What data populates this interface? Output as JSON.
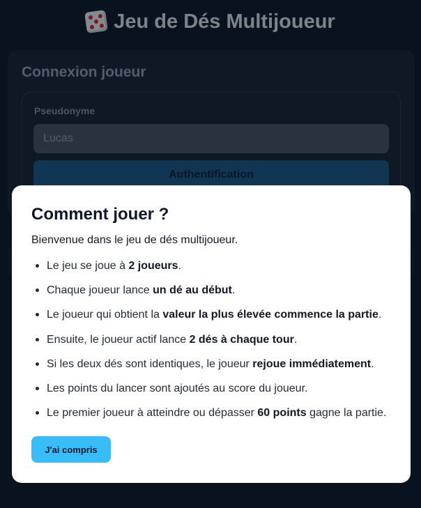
{
  "app": {
    "title_emoji": "🎲",
    "title": "Jeu de Dés Multijoueur"
  },
  "login": {
    "title": "Connexion joueur",
    "pseudo_label": "Pseudonyme",
    "pseudo_value": "Lucas",
    "auth_label": "Authentification"
  },
  "modal": {
    "title": "Comment jouer ?",
    "intro": "Bienvenue dans le jeu de dés multijoueur.",
    "rules": [
      {
        "before": "Le jeu se joue à ",
        "bold": "2 joueurs",
        "after": "."
      },
      {
        "before": "Chaque joueur lance ",
        "bold": "un dé au début",
        "after": "."
      },
      {
        "before": "Le joueur qui obtient la ",
        "bold": "valeur la plus élevée commence la partie",
        "after": "."
      },
      {
        "before": "Ensuite, le joueur actif lance ",
        "bold": "2 dés à chaque tour",
        "after": "."
      },
      {
        "before": "Si les deux dés sont identiques, le joueur ",
        "bold": "rejoue immédiatement",
        "after": "."
      },
      {
        "before": "Les points du lancer sont ajoutés au score du joueur.",
        "bold": "",
        "after": ""
      },
      {
        "before": "Le premier joueur à atteindre ou dépasser ",
        "bold": "60 points",
        "after": " gagne la partie."
      }
    ],
    "ok_label": "J'ai compris"
  },
  "colors": {
    "accent": "#38bdf8",
    "background": "#0f1b2c"
  }
}
